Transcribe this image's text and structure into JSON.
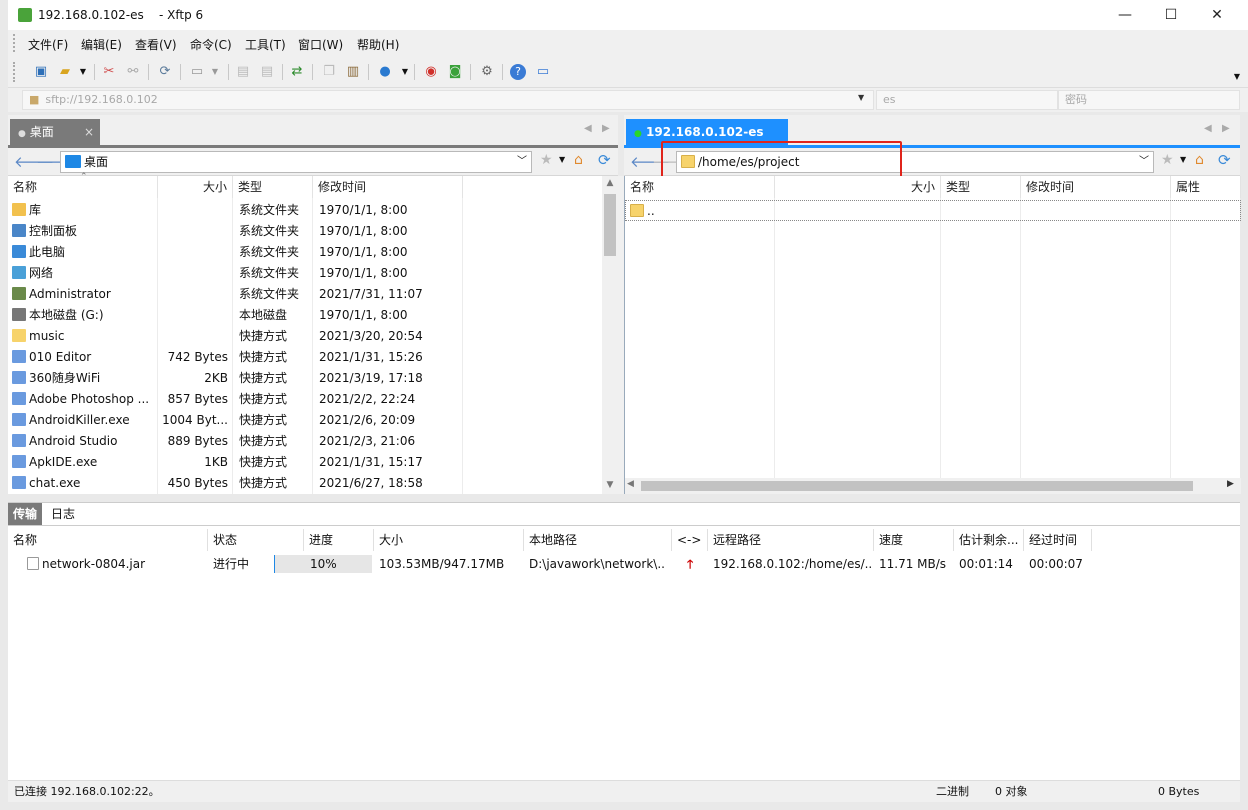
{
  "window": {
    "title": "192.168.0.102-es",
    "app_name": "- Xftp 6",
    "minimize": "—",
    "maximize": "☐",
    "close": "✕"
  },
  "menu": [
    "文件(F)",
    "编辑(E)",
    "查看(V)",
    "命令(C)",
    "工具(T)",
    "窗口(W)",
    "帮助(H)"
  ],
  "address_bar": {
    "url": "sftp://192.168.0.102",
    "user": "es",
    "password_placeholder": "密码"
  },
  "left_panel": {
    "tab": "桌面",
    "path": "桌面",
    "columns": [
      "名称",
      "大小",
      "类型",
      "修改时间"
    ],
    "rows": [
      {
        "name": "库",
        "size": "",
        "type": "系统文件夹",
        "modified": "1970/1/1, 8:00",
        "icon": "library-icon"
      },
      {
        "name": "控制面板",
        "size": "",
        "type": "系统文件夹",
        "modified": "1970/1/1, 8:00",
        "icon": "control-panel-icon"
      },
      {
        "name": "此电脑",
        "size": "",
        "type": "系统文件夹",
        "modified": "1970/1/1, 8:00",
        "icon": "computer-icon"
      },
      {
        "name": "网络",
        "size": "",
        "type": "系统文件夹",
        "modified": "1970/1/1, 8:00",
        "icon": "network-icon"
      },
      {
        "name": "Administrator",
        "size": "",
        "type": "系统文件夹",
        "modified": "2021/7/31, 11:07",
        "icon": "user-icon"
      },
      {
        "name": "本地磁盘 (G:)",
        "size": "",
        "type": "本地磁盘",
        "modified": "1970/1/1, 8:00",
        "icon": "drive-icon"
      },
      {
        "name": "music",
        "size": "",
        "type": "快捷方式",
        "modified": "2021/3/20, 20:54",
        "icon": "folder-shortcut-icon"
      },
      {
        "name": "010 Editor",
        "size": "742 Bytes",
        "type": "快捷方式",
        "modified": "2021/1/31, 15:26",
        "icon": "app-shortcut-icon"
      },
      {
        "name": "360随身WiFi",
        "size": "2KB",
        "type": "快捷方式",
        "modified": "2021/3/19, 17:18",
        "icon": "app-shortcut-icon"
      },
      {
        "name": "Adobe Photoshop ...",
        "size": "857 Bytes",
        "type": "快捷方式",
        "modified": "2021/2/2, 22:24",
        "icon": "app-shortcut-icon"
      },
      {
        "name": "AndroidKiller.exe",
        "size": "1004 Byt...",
        "type": "快捷方式",
        "modified": "2021/2/6, 20:09",
        "icon": "app-shortcut-icon"
      },
      {
        "name": "Android Studio",
        "size": "889 Bytes",
        "type": "快捷方式",
        "modified": "2021/2/3, 21:06",
        "icon": "app-shortcut-icon"
      },
      {
        "name": "ApkIDE.exe",
        "size": "1KB",
        "type": "快捷方式",
        "modified": "2021/1/31, 15:17",
        "icon": "app-shortcut-icon"
      },
      {
        "name": "chat.exe",
        "size": "450 Bytes",
        "type": "快捷方式",
        "modified": "2021/6/27, 18:58",
        "icon": "app-shortcut-icon"
      }
    ]
  },
  "right_panel": {
    "tab": "192.168.0.102-es",
    "path": "/home/es/project",
    "columns": [
      "名称",
      "大小",
      "类型",
      "修改时间",
      "属性"
    ],
    "rows": [
      {
        "name": ".."
      }
    ]
  },
  "transfer": {
    "tabs": [
      "传输",
      "日志"
    ],
    "columns": [
      "名称",
      "状态",
      "进度",
      "大小",
      "本地路径",
      "<->",
      "远程路径",
      "速度",
      "估计剩余...",
      "经过时间"
    ],
    "rows": [
      {
        "name": "network-0804.jar",
        "status": "进行中",
        "progress": 0.1,
        "progress_label": "10%",
        "size": "103.53MB/947.17MB",
        "local_path": "D:\\javawork\\network\\...",
        "direction": "upload-arrow-icon",
        "remote_path": "192.168.0.102:/home/es/...",
        "speed": "11.71 MB/s",
        "remaining": "00:01:14",
        "elapsed": "00:00:07"
      }
    ]
  },
  "status": {
    "connection": "已连接 192.168.0.102:22。",
    "mode": "二进制",
    "objects": "0 对象",
    "bytes": "0 Bytes"
  },
  "colors": {
    "accent": "#1e90ff",
    "highlight_box": "#e0241b",
    "folder": "#f7d36b",
    "upload_arrow": "#cc0000"
  }
}
